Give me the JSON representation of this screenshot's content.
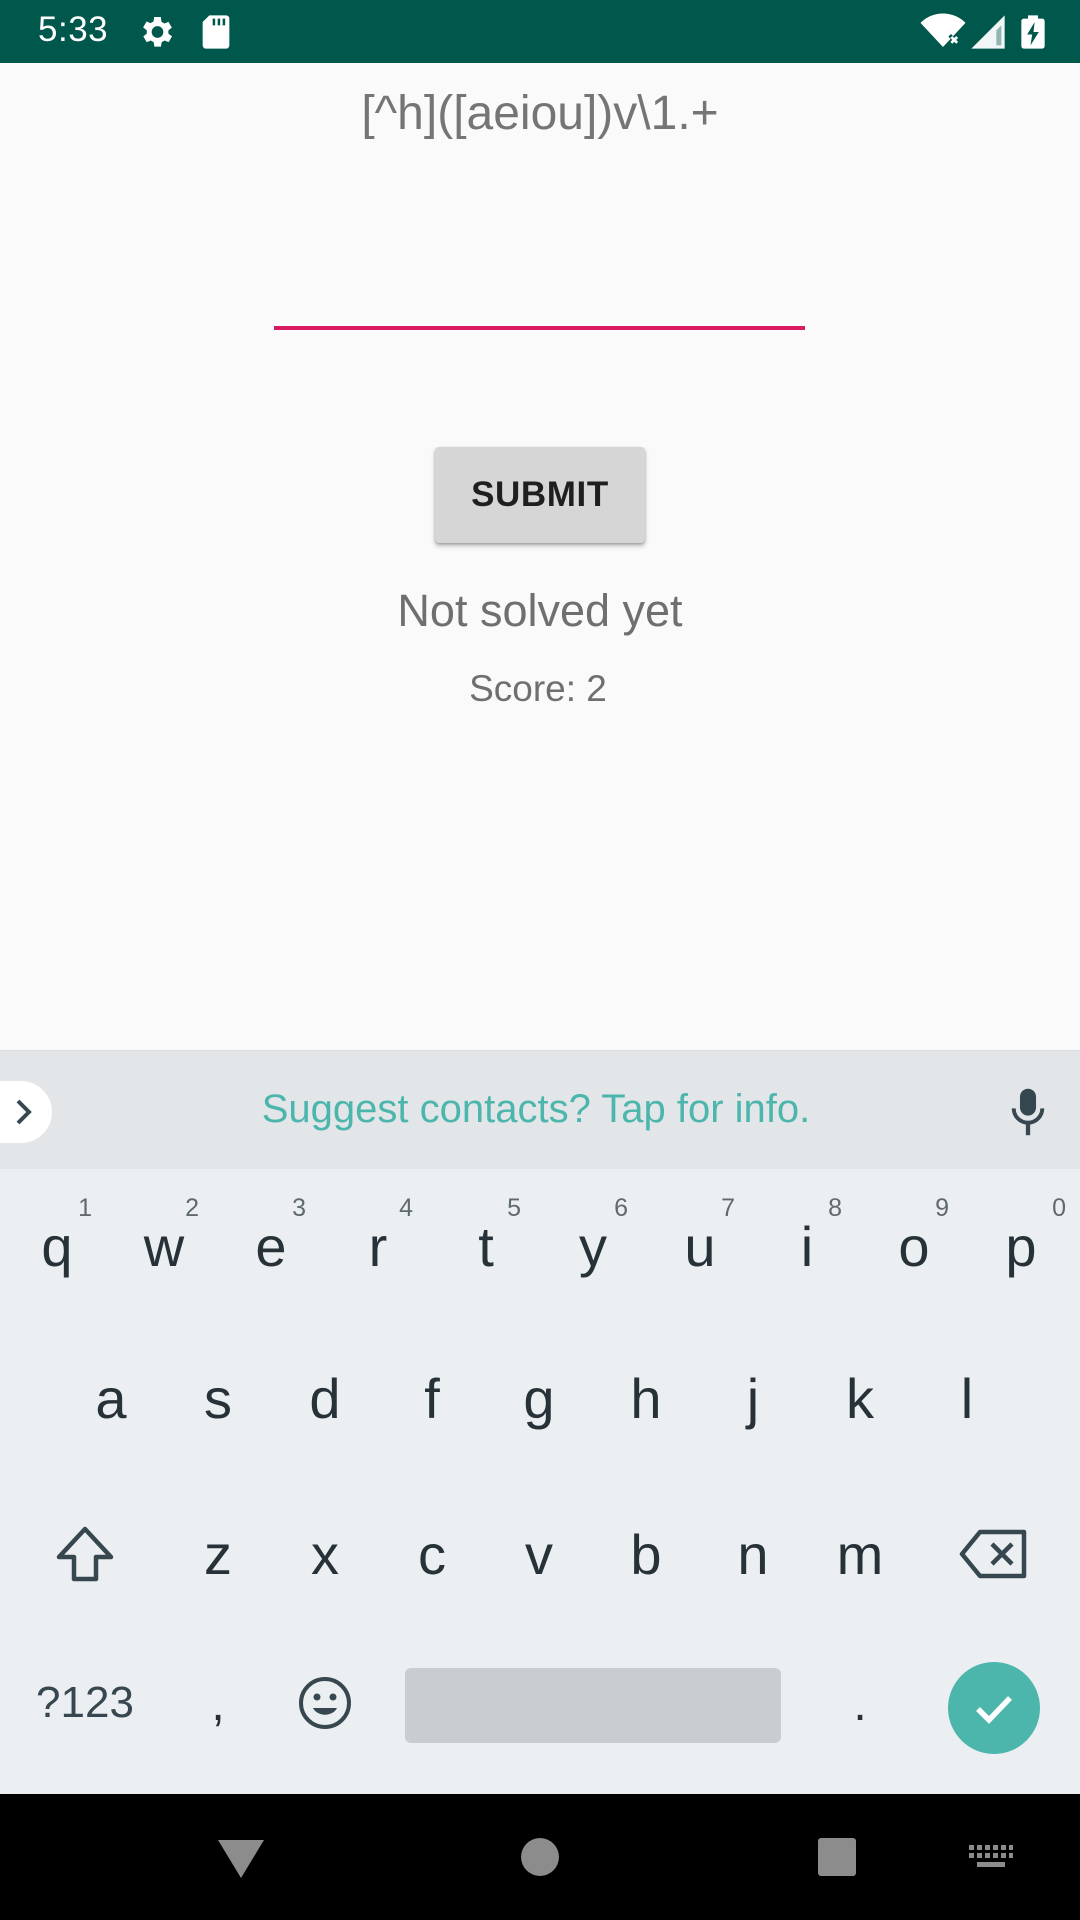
{
  "status_bar": {
    "time": "5:33",
    "icons": [
      "settings-icon",
      "sd-card-icon",
      "wifi-icon",
      "signal-icon",
      "battery-charging-icon"
    ]
  },
  "app": {
    "regex": "[^h]([aeiou])v\\1.+",
    "answer_value": "",
    "submit_label": "SUBMIT",
    "status": "Not solved yet",
    "score": "Score: 2"
  },
  "keyboard": {
    "suggestion": "Suggest contacts? Tap for info.",
    "row1": [
      {
        "key": "q",
        "hint": "1"
      },
      {
        "key": "w",
        "hint": "2"
      },
      {
        "key": "e",
        "hint": "3"
      },
      {
        "key": "r",
        "hint": "4"
      },
      {
        "key": "t",
        "hint": "5"
      },
      {
        "key": "y",
        "hint": "6"
      },
      {
        "key": "u",
        "hint": "7"
      },
      {
        "key": "i",
        "hint": "8"
      },
      {
        "key": "o",
        "hint": "9"
      },
      {
        "key": "p",
        "hint": "0"
      }
    ],
    "row2": [
      "a",
      "s",
      "d",
      "f",
      "g",
      "h",
      "j",
      "k",
      "l"
    ],
    "row3": [
      "z",
      "x",
      "c",
      "v",
      "b",
      "n",
      "m"
    ],
    "symbols_label": "?123",
    "comma": ",",
    "period": ".",
    "accent_color": "#4db6ac"
  },
  "colors": {
    "status_bar": "#00574b",
    "field_underline": "#d81b60",
    "button": "#d6d6d6"
  }
}
